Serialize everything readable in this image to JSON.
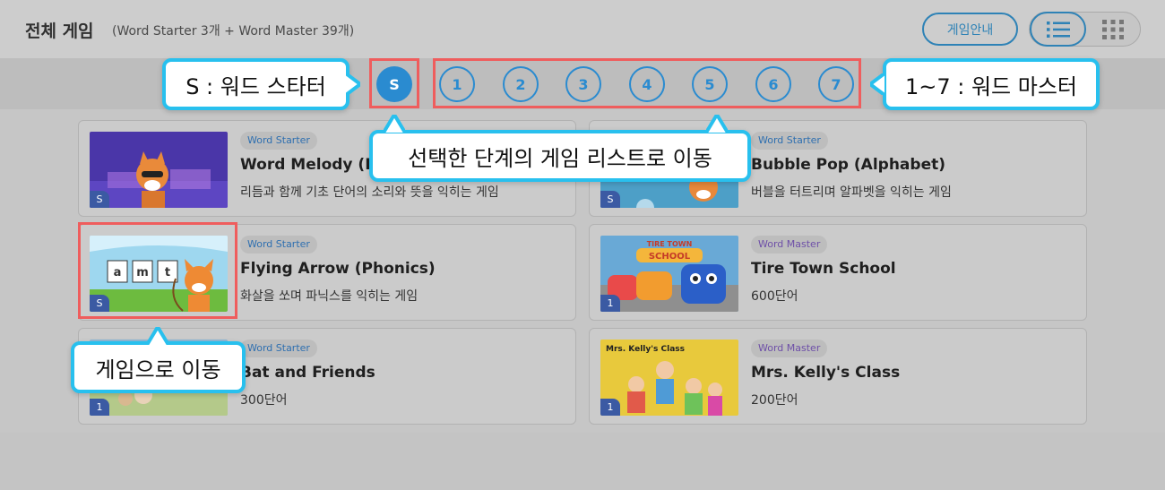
{
  "header": {
    "title": "전체 게임",
    "subtitle": "(Word Starter 3개 + Word Master 39개)",
    "guide_button": "게임안내"
  },
  "levels": {
    "starter": "S",
    "masters": [
      "1",
      "2",
      "3",
      "4",
      "5",
      "6",
      "7"
    ]
  },
  "callouts": {
    "starter": "S : 워드 스타터",
    "master": "1~7 : 워드 마스터",
    "level_select": "선택한 단계의 게임 리스트로 이동",
    "game_select": "게임으로 이동"
  },
  "cards": [
    {
      "tag": "Word Starter",
      "title": "Word Melody (Ba",
      "desc": "리듬과 함께 기초 단어의 소리와 뜻을 익히는 게임",
      "badge": "S"
    },
    {
      "tag": "Word Starter",
      "title": "Bubble Pop (Alphabet)",
      "desc": "버블을 터트리며 알파벳을 익히는 게임",
      "badge": "S"
    },
    {
      "tag": "Word Starter",
      "title": "Flying Arrow (Phonics)",
      "desc": "화살을 쏘며 파닉스를 익히는 게임",
      "badge": "S",
      "thumb_text": [
        "a",
        "m",
        "t"
      ]
    },
    {
      "tag": "Word Master",
      "title": "Tire Town School",
      "desc": "600단어",
      "badge": "1",
      "thumb_text": [
        "TIRE TOWN",
        "SCHOOL"
      ]
    },
    {
      "tag": "Word Starter",
      "title": "Bat and Friends",
      "desc": "300단어",
      "badge": "1"
    },
    {
      "tag": "Word Master",
      "title": "Mrs. Kelly's Class",
      "desc": "200단어",
      "badge": "1",
      "thumb_text": [
        "Mrs. Kelly's Class"
      ]
    }
  ],
  "colors": {
    "accent_blue": "#2a8bd0",
    "callout_border": "#28c0ee",
    "highlight_red": "#ef5d5d",
    "badge_blue": "#3b5aa3"
  },
  "icons": [
    "list-view-icon",
    "grid-view-icon"
  ]
}
